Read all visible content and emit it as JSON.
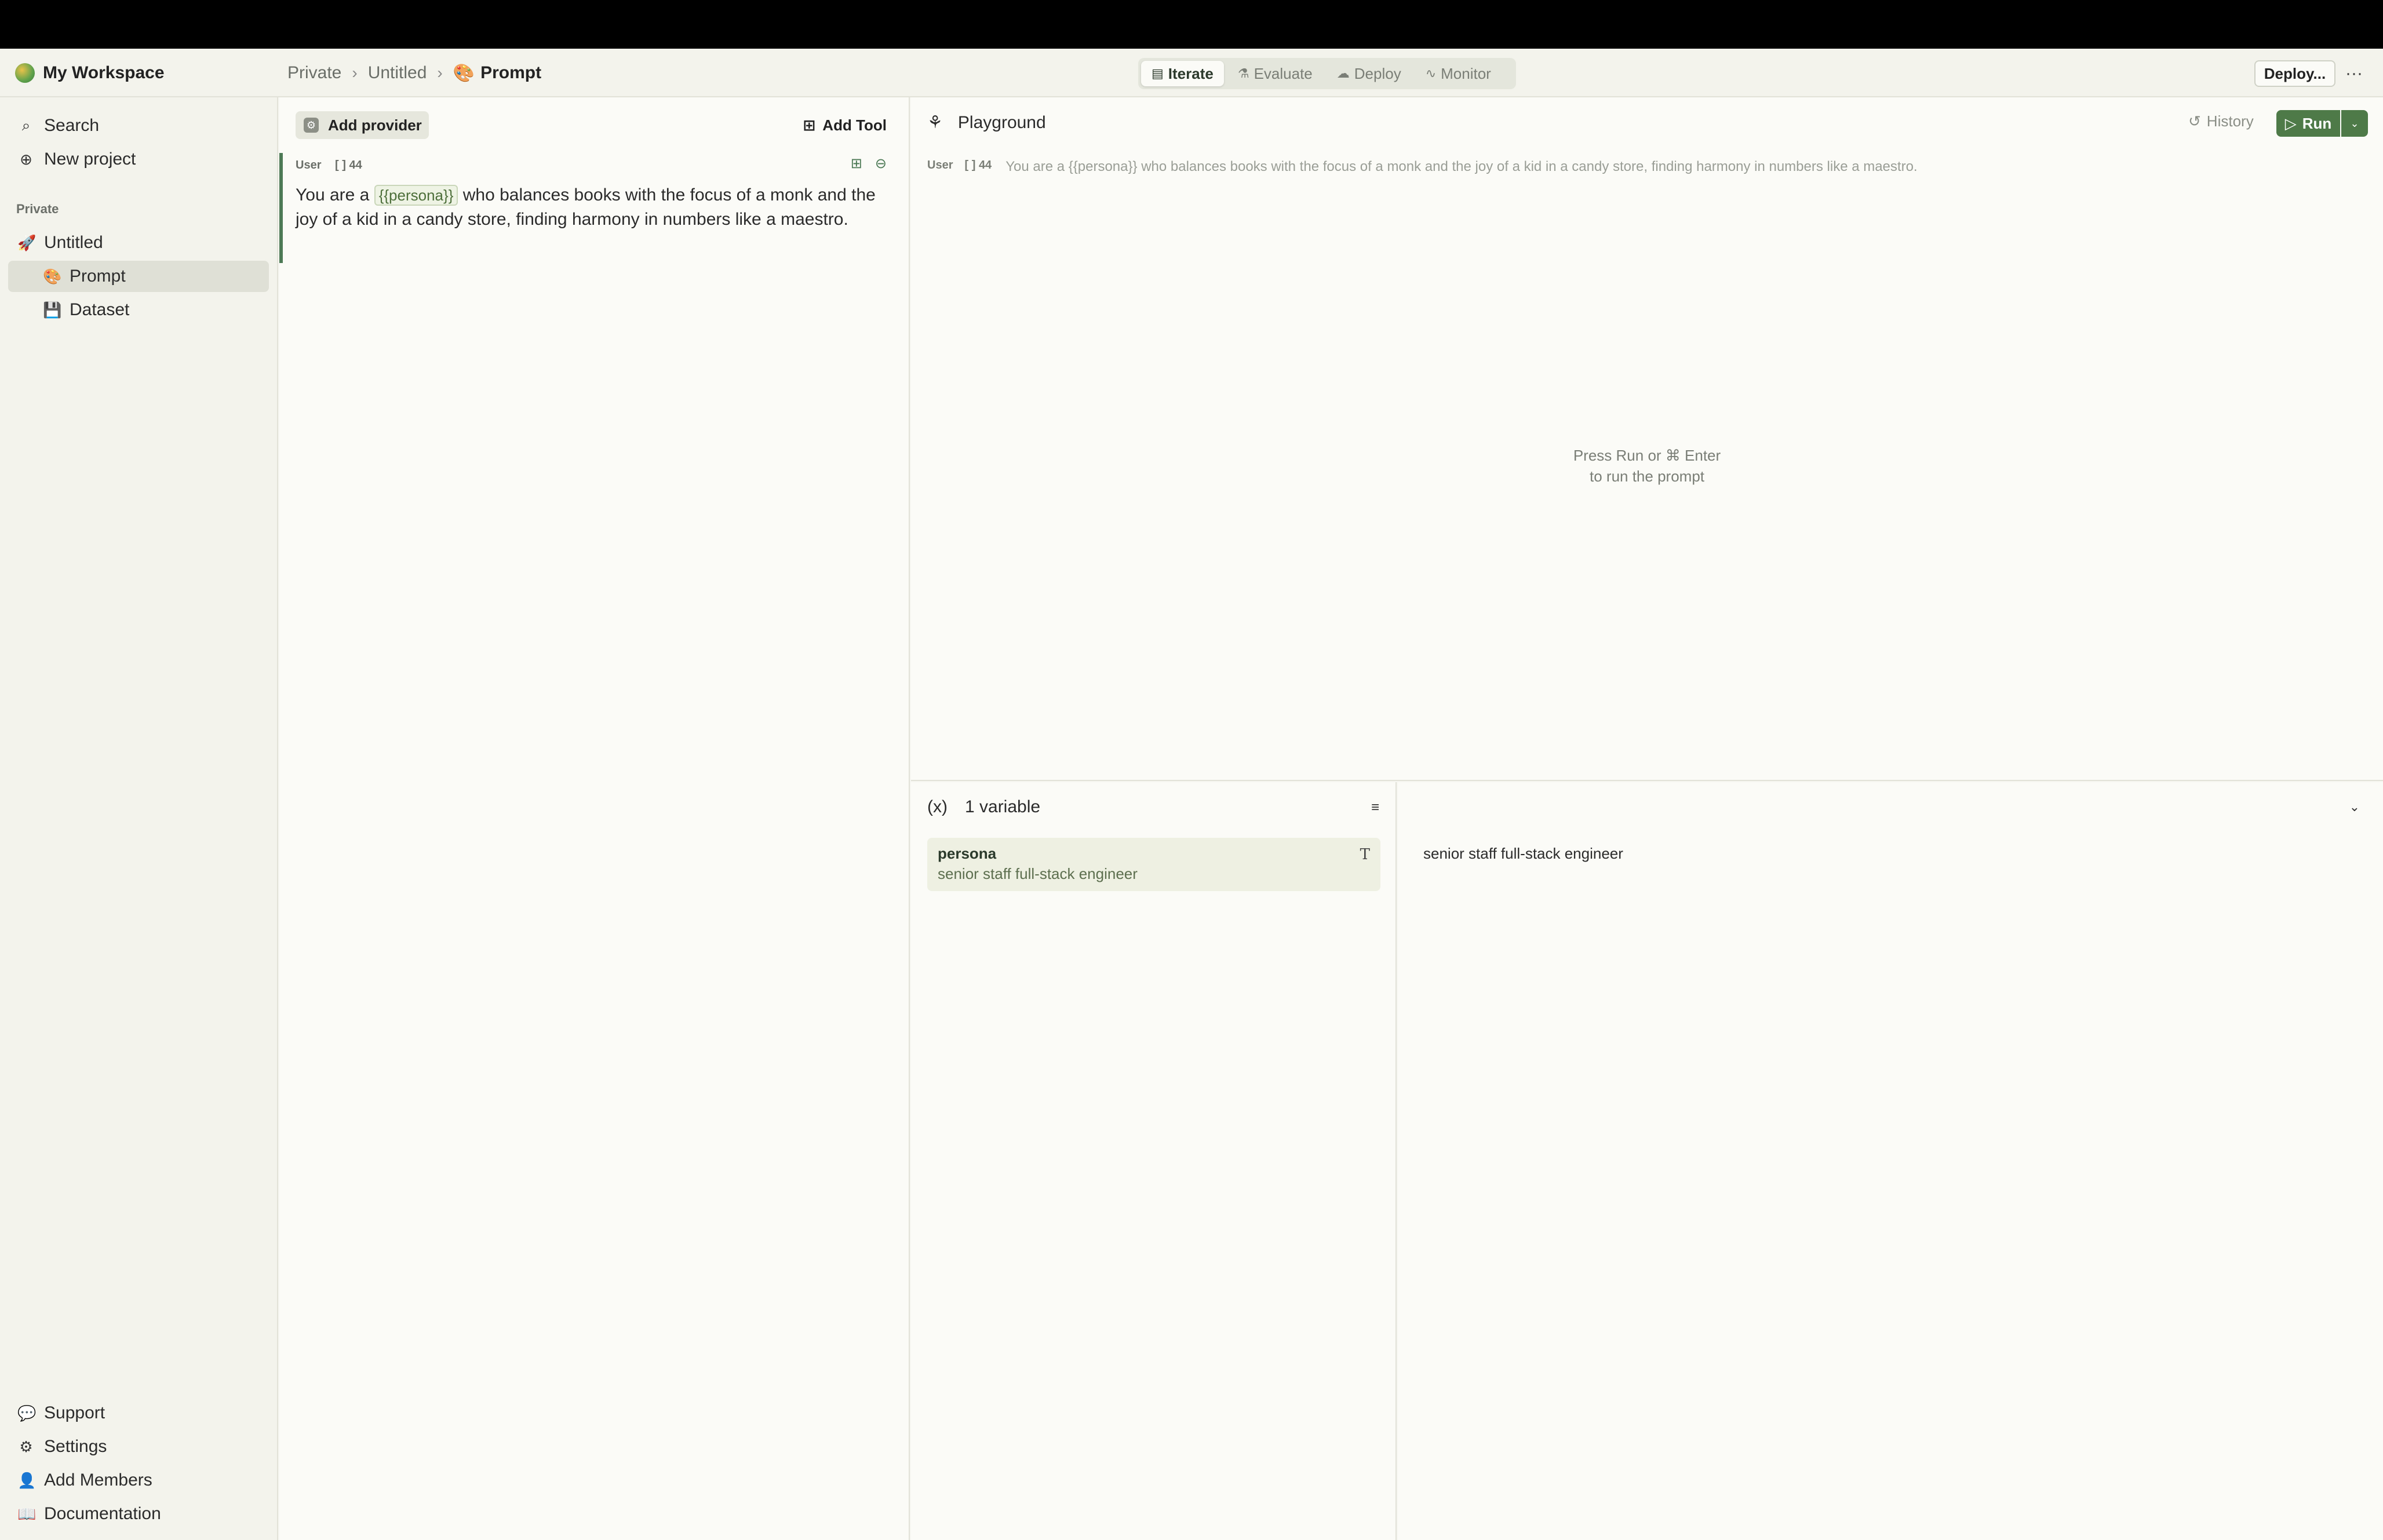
{
  "workspace": {
    "name": "My Workspace"
  },
  "breadcrumb": {
    "items": [
      "Private",
      "Untitled"
    ],
    "current": "Prompt",
    "separator": "›"
  },
  "modes": [
    {
      "label": "Iterate",
      "icon": "document-icon",
      "active": true
    },
    {
      "label": "Evaluate",
      "icon": "flask-icon",
      "active": false
    },
    {
      "label": "Deploy",
      "icon": "cloud-upload-icon",
      "active": false
    },
    {
      "label": "Monitor",
      "icon": "activity-icon",
      "active": false
    }
  ],
  "header_actions": {
    "deploy_label": "Deploy...",
    "more_label": "···"
  },
  "sidebar": {
    "search_label": "Search",
    "new_project_label": "New project",
    "section_label": "Private",
    "project_label": "Untitled",
    "prompt_label": "Prompt",
    "dataset_label": "Dataset",
    "support_label": "Support",
    "settings_label": "Settings",
    "add_members_label": "Add Members",
    "documentation_label": "Documentation"
  },
  "editor": {
    "add_provider_label": "Add provider",
    "add_tool_label": "Add Tool",
    "message": {
      "role": "User",
      "token_count": "44",
      "text_before": "You are a",
      "variable": "{{persona}}",
      "text_after": "who balances books with the focus of a monk and the joy of a kid in a candy store, finding harmony in numbers like a maestro."
    }
  },
  "playground": {
    "title": "Playground",
    "history_label": "History",
    "run_label": "Run",
    "message_role": "User",
    "message_tokens": "44",
    "message_text": "You are a {{persona}} who balances books with the focus of a monk and the joy of a kid in a candy store, finding harmony in numbers like a maestro.",
    "hint_line1": "Press Run or ⌘ Enter",
    "hint_line2": "to run the prompt"
  },
  "variables": {
    "title": "1 variable",
    "items": [
      {
        "name": "persona",
        "value": "senior staff full-stack engineer",
        "type": "T"
      }
    ],
    "detail_value": "senior staff full-stack engineer"
  },
  "colors": {
    "accent": "#4e7a48",
    "sidebar_bg": "#f3f3ec",
    "panel_bg": "#fbfbf7"
  }
}
